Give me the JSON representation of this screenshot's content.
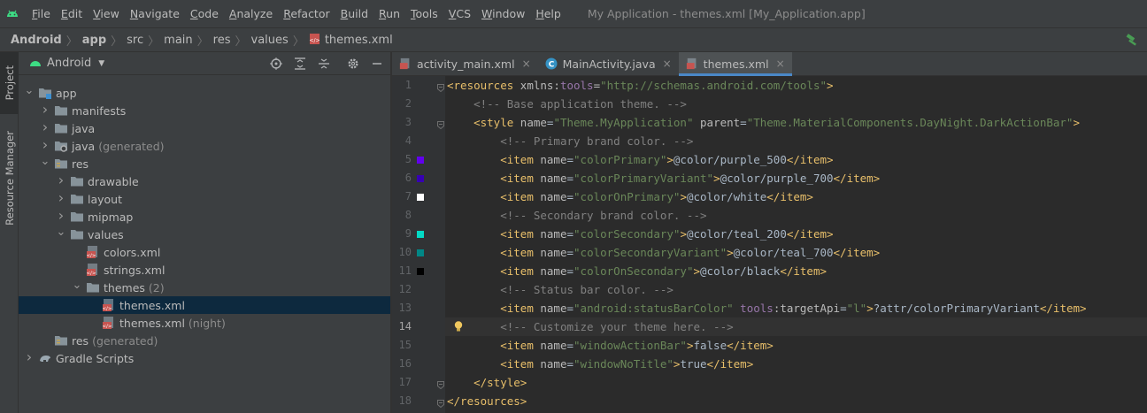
{
  "menubar": {
    "items": [
      "File",
      "Edit",
      "View",
      "Navigate",
      "Code",
      "Analyze",
      "Refactor",
      "Build",
      "Run",
      "Tools",
      "VCS",
      "Window",
      "Help"
    ],
    "window_title": "My Application - themes.xml [My_Application.app]"
  },
  "breadcrumb": [
    "Android",
    "app",
    "src",
    "main",
    "res",
    "values",
    "themes.xml"
  ],
  "side_tabs": {
    "project": "Project",
    "resource_manager": "Resource Manager"
  },
  "project_panel": {
    "view_mode": "Android"
  },
  "tree": [
    {
      "label": "app",
      "note": "",
      "depth": 0,
      "chev": "down",
      "icon": "module-folder-icon"
    },
    {
      "label": "manifests",
      "note": "",
      "depth": 1,
      "chev": "right",
      "icon": "folder-icon"
    },
    {
      "label": "java",
      "note": "",
      "depth": 1,
      "chev": "right",
      "icon": "folder-icon"
    },
    {
      "label": "java",
      "note": "(generated)",
      "depth": 1,
      "chev": "right",
      "icon": "generated-folder-icon"
    },
    {
      "label": "res",
      "note": "",
      "depth": 1,
      "chev": "down",
      "icon": "res-folder-icon"
    },
    {
      "label": "drawable",
      "note": "",
      "depth": 2,
      "chev": "right",
      "icon": "folder-icon"
    },
    {
      "label": "layout",
      "note": "",
      "depth": 2,
      "chev": "right",
      "icon": "folder-icon"
    },
    {
      "label": "mipmap",
      "note": "",
      "depth": 2,
      "chev": "right",
      "icon": "folder-icon"
    },
    {
      "label": "values",
      "note": "",
      "depth": 2,
      "chev": "down",
      "icon": "folder-icon"
    },
    {
      "label": "colors.xml",
      "note": "",
      "depth": 3,
      "chev": "",
      "icon": "xml-file-icon"
    },
    {
      "label": "strings.xml",
      "note": "",
      "depth": 3,
      "chev": "",
      "icon": "xml-file-icon"
    },
    {
      "label": "themes",
      "note": "(2)",
      "depth": 3,
      "chev": "down",
      "icon": "folder-icon"
    },
    {
      "label": "themes.xml",
      "note": "",
      "depth": 4,
      "chev": "",
      "icon": "xml-file-icon",
      "selected": true
    },
    {
      "label": "themes.xml",
      "note": "(night)",
      "depth": 4,
      "chev": "",
      "icon": "xml-file-icon"
    },
    {
      "label": "res",
      "note": "(generated)",
      "depth": 1,
      "chev": "",
      "icon": "res-folder-icon"
    },
    {
      "label": "Gradle Scripts",
      "note": "",
      "depth": 0,
      "chev": "right",
      "icon": "gradle-icon"
    }
  ],
  "tabs": [
    {
      "label": "activity_main.xml",
      "icon": "xml-file-icon",
      "active": false
    },
    {
      "label": "MainActivity.java",
      "icon": "java-class-icon",
      "active": false
    },
    {
      "label": "themes.xml",
      "icon": "xml-file-icon",
      "active": true
    }
  ],
  "code": [
    {
      "n": "1",
      "fold": true,
      "swatch": "",
      "tokens": [
        [
          "tag",
          "<resources "
        ],
        [
          "attr",
          "xmlns:"
        ],
        [
          "ns",
          "tools"
        ],
        [
          "attr",
          "="
        ],
        [
          "val",
          "\"http://schemas.android.com/tools\""
        ],
        [
          "tag",
          ">"
        ]
      ]
    },
    {
      "n": "2",
      "fold": false,
      "swatch": "",
      "tokens": [
        [
          "txt",
          "    "
        ],
        [
          "com",
          "<!-- Base application theme. -->"
        ]
      ]
    },
    {
      "n": "3",
      "fold": true,
      "swatch": "",
      "tokens": [
        [
          "txt",
          "    "
        ],
        [
          "tag",
          "<style "
        ],
        [
          "attr",
          "name"
        ],
        [
          "txt",
          "="
        ],
        [
          "val",
          "\"Theme.MyApplication\""
        ],
        [
          "txt",
          " "
        ],
        [
          "attr",
          "parent"
        ],
        [
          "txt",
          "="
        ],
        [
          "val",
          "\"Theme.MaterialComponents.DayNight.DarkActionBar\""
        ],
        [
          "tag",
          ">"
        ]
      ]
    },
    {
      "n": "4",
      "fold": false,
      "swatch": "",
      "tokens": [
        [
          "txt",
          "        "
        ],
        [
          "com",
          "<!-- Primary brand color. -->"
        ]
      ]
    },
    {
      "n": "5",
      "fold": false,
      "swatch": "#6200ee",
      "tokens": [
        [
          "txt",
          "        "
        ],
        [
          "tag",
          "<item "
        ],
        [
          "attr",
          "name"
        ],
        [
          "txt",
          "="
        ],
        [
          "val",
          "\"colorPrimary\""
        ],
        [
          "tag",
          ">"
        ],
        [
          "txt",
          "@color/purple_500"
        ],
        [
          "tag",
          "</item>"
        ]
      ]
    },
    {
      "n": "6",
      "fold": false,
      "swatch": "#3700b3",
      "tokens": [
        [
          "txt",
          "        "
        ],
        [
          "tag",
          "<item "
        ],
        [
          "attr",
          "name"
        ],
        [
          "txt",
          "="
        ],
        [
          "val",
          "\"colorPrimaryVariant\""
        ],
        [
          "tag",
          ">"
        ],
        [
          "txt",
          "@color/purple_700"
        ],
        [
          "tag",
          "</item>"
        ]
      ]
    },
    {
      "n": "7",
      "fold": false,
      "swatch": "#ffffff",
      "tokens": [
        [
          "txt",
          "        "
        ],
        [
          "tag",
          "<item "
        ],
        [
          "attr",
          "name"
        ],
        [
          "txt",
          "="
        ],
        [
          "val",
          "\"colorOnPrimary\""
        ],
        [
          "tag",
          ">"
        ],
        [
          "txt",
          "@color/white"
        ],
        [
          "tag",
          "</item>"
        ]
      ]
    },
    {
      "n": "8",
      "fold": false,
      "swatch": "",
      "tokens": [
        [
          "txt",
          "        "
        ],
        [
          "com",
          "<!-- Secondary brand color. -->"
        ]
      ]
    },
    {
      "n": "9",
      "fold": false,
      "swatch": "#03dac5",
      "tokens": [
        [
          "txt",
          "        "
        ],
        [
          "tag",
          "<item "
        ],
        [
          "attr",
          "name"
        ],
        [
          "txt",
          "="
        ],
        [
          "val",
          "\"colorSecondary\""
        ],
        [
          "tag",
          ">"
        ],
        [
          "txt",
          "@color/teal_200"
        ],
        [
          "tag",
          "</item>"
        ]
      ]
    },
    {
      "n": "10",
      "fold": false,
      "swatch": "#018786",
      "tokens": [
        [
          "txt",
          "        "
        ],
        [
          "tag",
          "<item "
        ],
        [
          "attr",
          "name"
        ],
        [
          "txt",
          "="
        ],
        [
          "val",
          "\"colorSecondaryVariant\""
        ],
        [
          "tag",
          ">"
        ],
        [
          "txt",
          "@color/teal_700"
        ],
        [
          "tag",
          "</item>"
        ]
      ]
    },
    {
      "n": "11",
      "fold": false,
      "swatch": "#000000",
      "tokens": [
        [
          "txt",
          "        "
        ],
        [
          "tag",
          "<item "
        ],
        [
          "attr",
          "name"
        ],
        [
          "txt",
          "="
        ],
        [
          "val",
          "\"colorOnSecondary\""
        ],
        [
          "tag",
          ">"
        ],
        [
          "txt",
          "@color/black"
        ],
        [
          "tag",
          "</item>"
        ]
      ]
    },
    {
      "n": "12",
      "fold": false,
      "swatch": "",
      "tokens": [
        [
          "txt",
          "        "
        ],
        [
          "com",
          "<!-- Status bar color. -->"
        ]
      ]
    },
    {
      "n": "13",
      "fold": false,
      "swatch": "",
      "tokens": [
        [
          "txt",
          "        "
        ],
        [
          "tag",
          "<item "
        ],
        [
          "attr",
          "name"
        ],
        [
          "txt",
          "="
        ],
        [
          "val",
          "\"android:statusBarColor\""
        ],
        [
          "txt",
          " "
        ],
        [
          "ns",
          "tools"
        ],
        [
          "attr",
          ":targetApi"
        ],
        [
          "txt",
          "="
        ],
        [
          "val",
          "\"l\""
        ],
        [
          "tag",
          ">"
        ],
        [
          "txt",
          "?attr/colorPrimaryVariant"
        ],
        [
          "tag",
          "</item>"
        ]
      ]
    },
    {
      "n": "14",
      "fold": false,
      "swatch": "",
      "current": true,
      "bulb": true,
      "tokens": [
        [
          "txt",
          "        "
        ],
        [
          "com",
          "<!-- Customize your theme here. -->"
        ]
      ]
    },
    {
      "n": "15",
      "fold": false,
      "swatch": "",
      "tokens": [
        [
          "txt",
          "        "
        ],
        [
          "tag",
          "<item "
        ],
        [
          "attr",
          "name"
        ],
        [
          "txt",
          "="
        ],
        [
          "val",
          "\"windowActionBar\""
        ],
        [
          "tag",
          ">"
        ],
        [
          "txt",
          "false"
        ],
        [
          "tag",
          "</item>"
        ]
      ]
    },
    {
      "n": "16",
      "fold": false,
      "swatch": "",
      "tokens": [
        [
          "txt",
          "        "
        ],
        [
          "tag",
          "<item "
        ],
        [
          "attr",
          "name"
        ],
        [
          "txt",
          "="
        ],
        [
          "val",
          "\"windowNoTitle\""
        ],
        [
          "tag",
          ">"
        ],
        [
          "txt",
          "true"
        ],
        [
          "tag",
          "</item>"
        ]
      ]
    },
    {
      "n": "17",
      "fold": true,
      "swatch": "",
      "tokens": [
        [
          "txt",
          "    "
        ],
        [
          "tag",
          "</style>"
        ]
      ]
    },
    {
      "n": "18",
      "fold": true,
      "swatch": "",
      "tokens": [
        [
          "tag",
          "</resources>"
        ]
      ]
    }
  ]
}
